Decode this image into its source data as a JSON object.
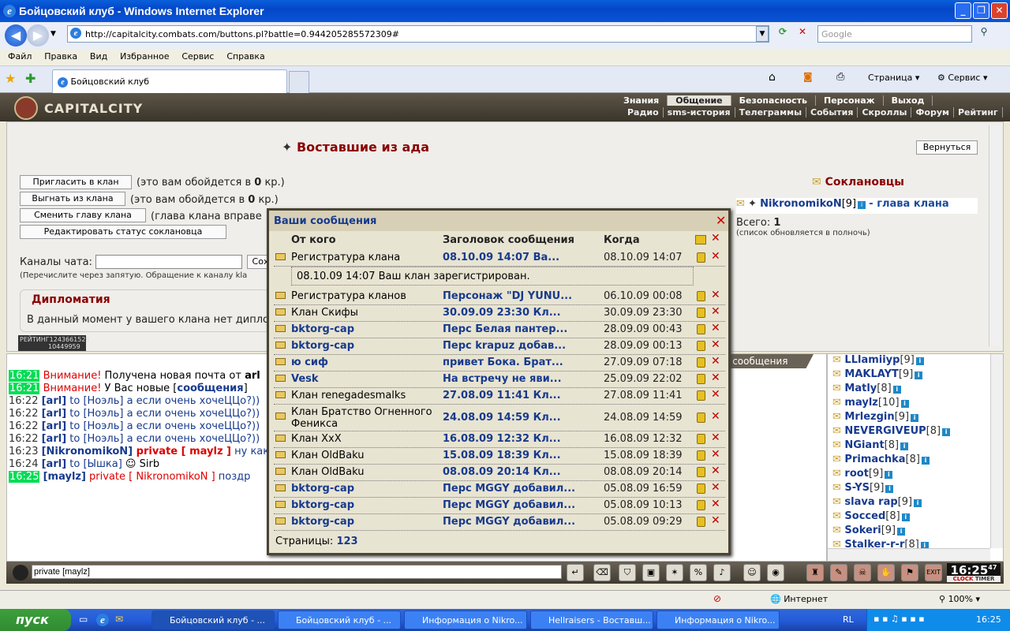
{
  "window": {
    "title": "Бойцовский клуб - Windows Internet Explorer",
    "address": "http://capitalcity.combats.com/buttons.pl?battle=0.944205285572309#",
    "search_placeholder": "Google"
  },
  "menu": [
    "Файл",
    "Правка",
    "Вид",
    "Избранное",
    "Сервис",
    "Справка"
  ],
  "tab": {
    "label": "Бойцовский клуб"
  },
  "toolbar_right": {
    "page": "Страница",
    "service": "Сервис"
  },
  "game": {
    "logo": "CAPITALCITY",
    "nav_top": [
      "Знания",
      "Общение",
      "Безопасность",
      "Персонаж",
      "Выход"
    ],
    "nav_sub": [
      "Радио",
      "sms-история",
      "Телеграммы",
      "События",
      "Скроллы",
      "Форум",
      "Рейтинг"
    ]
  },
  "clan": {
    "name": "Воставшие из ада",
    "back_button": "Вернуться",
    "buttons": [
      {
        "label": "Пригласить в клан",
        "note_pre": "(это вам обойдется в ",
        "cost": "0",
        "note_post": " кр.)"
      },
      {
        "label": "Выгнать из клана",
        "note_pre": "(это вам обойдется в ",
        "cost": "0",
        "note_post": " кр.)"
      },
      {
        "label": "Сменить главу клана",
        "note_pre": "(глава клана вправе ",
        "cost": "",
        "note_post": ""
      }
    ],
    "edit_status": "Редактировать статус соклановца",
    "chat_channels_label": "Каналы чата:",
    "chat_channels_button": "Сох",
    "chat_hint": "(Перечислите через запятую. Обращение к каналу kla",
    "diplomacy_title": "Дипломатия",
    "diplomacy_text": "В данный момент у вашего клана нет диплом",
    "rating": "РЕЙТИНГ",
    "rating_num1": "1243661526",
    "rating_num2": "10449959",
    "members_title": "Соклановцы",
    "leader": {
      "name": "NikronomikoN",
      "level": "[9]",
      "role": "- глава клана"
    },
    "total_label": "Всего:",
    "total": "1",
    "total_note": "(список обновляется в полночь)"
  },
  "chat": {
    "tab_label": "е сообщения",
    "lines": [
      {
        "time": "16:21",
        "hl": true,
        "parts": [
          {
            "t": "Внимание!",
            "c": "red"
          },
          {
            "t": " Получена новая почта от ",
            "c": ""
          },
          {
            "t": "arl",
            "c": "b"
          }
        ]
      },
      {
        "time": "16:21",
        "hl": true,
        "parts": [
          {
            "t": "Внимание!",
            "c": "red"
          },
          {
            "t": " У Вас новые [",
            "c": ""
          },
          {
            "t": "сообщения",
            "c": "blue"
          },
          {
            "t": "]",
            "c": ""
          }
        ]
      },
      {
        "time": "16:22",
        "hl": false,
        "parts": [
          {
            "t": "[arl]",
            "c": "blue"
          },
          {
            "t": " to [Ноэль] а если очень хочеЦЦо?))",
            "c": "blue2"
          }
        ]
      },
      {
        "time": "16:22",
        "hl": false,
        "parts": [
          {
            "t": "[arl]",
            "c": "blue"
          },
          {
            "t": " to [Ноэль] а если очень хочеЦЦо?))",
            "c": "blue2"
          }
        ]
      },
      {
        "time": "16:22",
        "hl": false,
        "parts": [
          {
            "t": "[arl]",
            "c": "blue"
          },
          {
            "t": " to [Ноэль] а если очень хочеЦЦо?))",
            "c": "blue2"
          }
        ]
      },
      {
        "time": "16:22",
        "hl": false,
        "parts": [
          {
            "t": "[arl]",
            "c": "blue"
          },
          {
            "t": " to [Ноэль] а если очень хочеЦЦо?))",
            "c": "blue2"
          }
        ]
      },
      {
        "time": "16:23",
        "hl": false,
        "parts": [
          {
            "t": "[NikronomikoN]",
            "c": "blue"
          },
          {
            "t": " private [ maylz ]",
            "c": "red"
          },
          {
            "t": " ну как",
            "c": "blue2"
          }
        ]
      },
      {
        "time": "16:24",
        "hl": false,
        "parts": [
          {
            "t": "[arl]",
            "c": "blue"
          },
          {
            "t": " to [Ышка]",
            "c": "blue2"
          },
          {
            "t": "  ☺  Sirb",
            "c": ""
          }
        ]
      },
      {
        "time": "16:25",
        "hl": true,
        "parts": [
          {
            "t": "[maylz]",
            "c": "blue"
          },
          {
            "t": " private [ NikronomikoN ]",
            "c": "red"
          },
          {
            "t": " поздр",
            "c": "blue2"
          }
        ]
      }
    ],
    "input_value": "private [maylz]"
  },
  "users": [
    {
      "name": "LLlamiiyp",
      "level": "[9]",
      "info": "i"
    },
    {
      "name": "MAKLAYT",
      "level": "[9]",
      "info": "i"
    },
    {
      "name": "Matly",
      "level": "[8]",
      "info": "i"
    },
    {
      "name": "maylz",
      "level": "[10]",
      "info": "i"
    },
    {
      "name": "Mrlezgin",
      "level": "[9]",
      "info": "i"
    },
    {
      "name": "NEVERGIVEUP",
      "level": "[8]",
      "info": "i"
    },
    {
      "name": "NGiant",
      "level": "[8]",
      "info": "i"
    },
    {
      "name": "Primachka",
      "level": "[8]",
      "info": "i"
    },
    {
      "name": "root",
      "level": "[9]",
      "info": "i"
    },
    {
      "name": "S-YS",
      "level": "[9]",
      "info": "i"
    },
    {
      "name": "slava rap",
      "level": "[9]",
      "info": "i"
    },
    {
      "name": "Socced",
      "level": "[8]",
      "info": "i"
    },
    {
      "name": "Sokeri",
      "level": "[9]",
      "info": "i"
    },
    {
      "name": "Stalker-r-r",
      "level": "[8]",
      "info": "i"
    }
  ],
  "messages": {
    "title": "Ваши сообщения",
    "headers": {
      "from": "От кого",
      "subject": "Заголовок сообщения",
      "when": "Когда"
    },
    "expanded_text": "08.10.09 14:07 Ваш клан зарегистрирован.",
    "rows": [
      {
        "from": "Регистратура клана",
        "from_bold": false,
        "subject": "08.10.09 14:07 Ва...",
        "when": "08.10.09 14:07"
      },
      {
        "from": "Регистратура кланов",
        "from_bold": false,
        "subject": "Персонаж \"DJ YUNU...",
        "when": "06.10.09 00:08"
      },
      {
        "from": "Клан Скифы",
        "from_bold": false,
        "subject": "30.09.09 23:30 Кл...",
        "when": "30.09.09 23:30"
      },
      {
        "from": "bktorg-cap",
        "from_bold": true,
        "subject": "Перс Белая пантер...",
        "when": "28.09.09 00:43"
      },
      {
        "from": "bktorg-cap",
        "from_bold": true,
        "subject": "Перс krapuz добав...",
        "when": "28.09.09 00:13"
      },
      {
        "from": "ю сиф",
        "from_bold": true,
        "subject": "привет Бока. Брат...",
        "when": "27.09.09 07:18"
      },
      {
        "from": "Vesk",
        "from_bold": true,
        "subject": "На встречу не яви...",
        "when": "25.09.09 22:02"
      },
      {
        "from": "Клан renegadesmalks",
        "from_bold": false,
        "subject": "27.08.09 11:41 Кл...",
        "when": "27.08.09 11:41"
      },
      {
        "from": "Клан Братство Огненного Феникса",
        "from_bold": false,
        "subject": "24.08.09 14:59 Кл...",
        "when": "24.08.09 14:59"
      },
      {
        "from": "Клан XxX",
        "from_bold": false,
        "subject": "16.08.09 12:32 Кл...",
        "when": "16.08.09 12:32"
      },
      {
        "from": "Клан OldBaku",
        "from_bold": false,
        "subject": "15.08.09 18:39 Кл...",
        "when": "15.08.09 18:39"
      },
      {
        "from": "Клан OldBaku",
        "from_bold": false,
        "subject": "08.08.09 20:14 Кл...",
        "when": "08.08.09 20:14"
      },
      {
        "from": "bktorg-cap",
        "from_bold": true,
        "subject": "Перс MGGY добавил...",
        "when": "05.08.09 16:59"
      },
      {
        "from": "bktorg-cap",
        "from_bold": true,
        "subject": "Перс MGGY добавил...",
        "when": "05.08.09 10:13"
      },
      {
        "from": "bktorg-cap",
        "from_bold": true,
        "subject": "Перс MGGY добавил...",
        "when": "05.08.09 09:29"
      }
    ],
    "pages_label": "Страницы:",
    "pages": "123"
  },
  "clock": {
    "time": "16:25",
    "seconds": "47",
    "clock_label": "CLOCK",
    "timer_label": "TIMER"
  },
  "status": {
    "zone": "Интернет",
    "zoom": "100%"
  },
  "taskbar": {
    "start": "пуск",
    "tasks": [
      "Бойцовский клуб - ...",
      "Бойцовский клуб - ...",
      "Информация о Nikro...",
      "Hellraisers - Воставш...",
      "Информация о Nikro..."
    ],
    "lang": "RL",
    "time": "16:25"
  }
}
